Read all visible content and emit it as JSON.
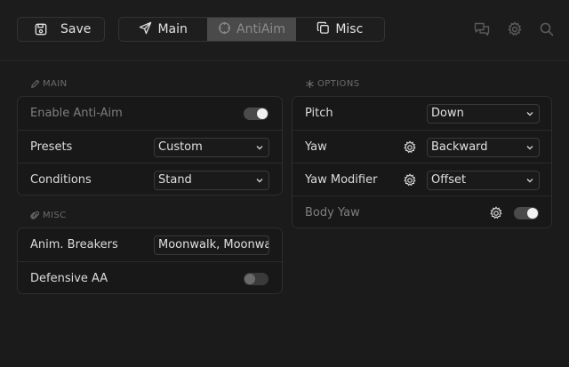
{
  "toolbar": {
    "save_label": "Save"
  },
  "tabs": [
    {
      "label": "Main",
      "icon": "send-icon",
      "active": false
    },
    {
      "label": "AntiAim",
      "icon": "crosshair-icon",
      "active": true
    },
    {
      "label": "Misc",
      "icon": "copy-icon",
      "active": false
    }
  ],
  "main_section": {
    "title": "MAIN",
    "enable_label": "Enable Anti-Aim",
    "enable_on": true,
    "presets_label": "Presets",
    "presets_value": "Custom",
    "conditions_label": "Conditions",
    "conditions_value": "Stand"
  },
  "misc_section": {
    "title": "MISC",
    "breakers_label": "Anim. Breakers",
    "breakers_value": "Moonwalk, Moonwalk",
    "defensive_label": "Defensive AA",
    "defensive_on": false
  },
  "options_section": {
    "title": "OPTIONS",
    "pitch_label": "Pitch",
    "pitch_value": "Down",
    "yaw_label": "Yaw",
    "yaw_value": "Backward",
    "yaw_modifier_label": "Yaw Modifier",
    "yaw_modifier_value": "Offset",
    "body_yaw_label": "Body Yaw",
    "body_yaw_on": true
  },
  "colors": {
    "background": "#1b1b1b",
    "panel": "#181818",
    "active_tab": "#4a4a4a"
  }
}
